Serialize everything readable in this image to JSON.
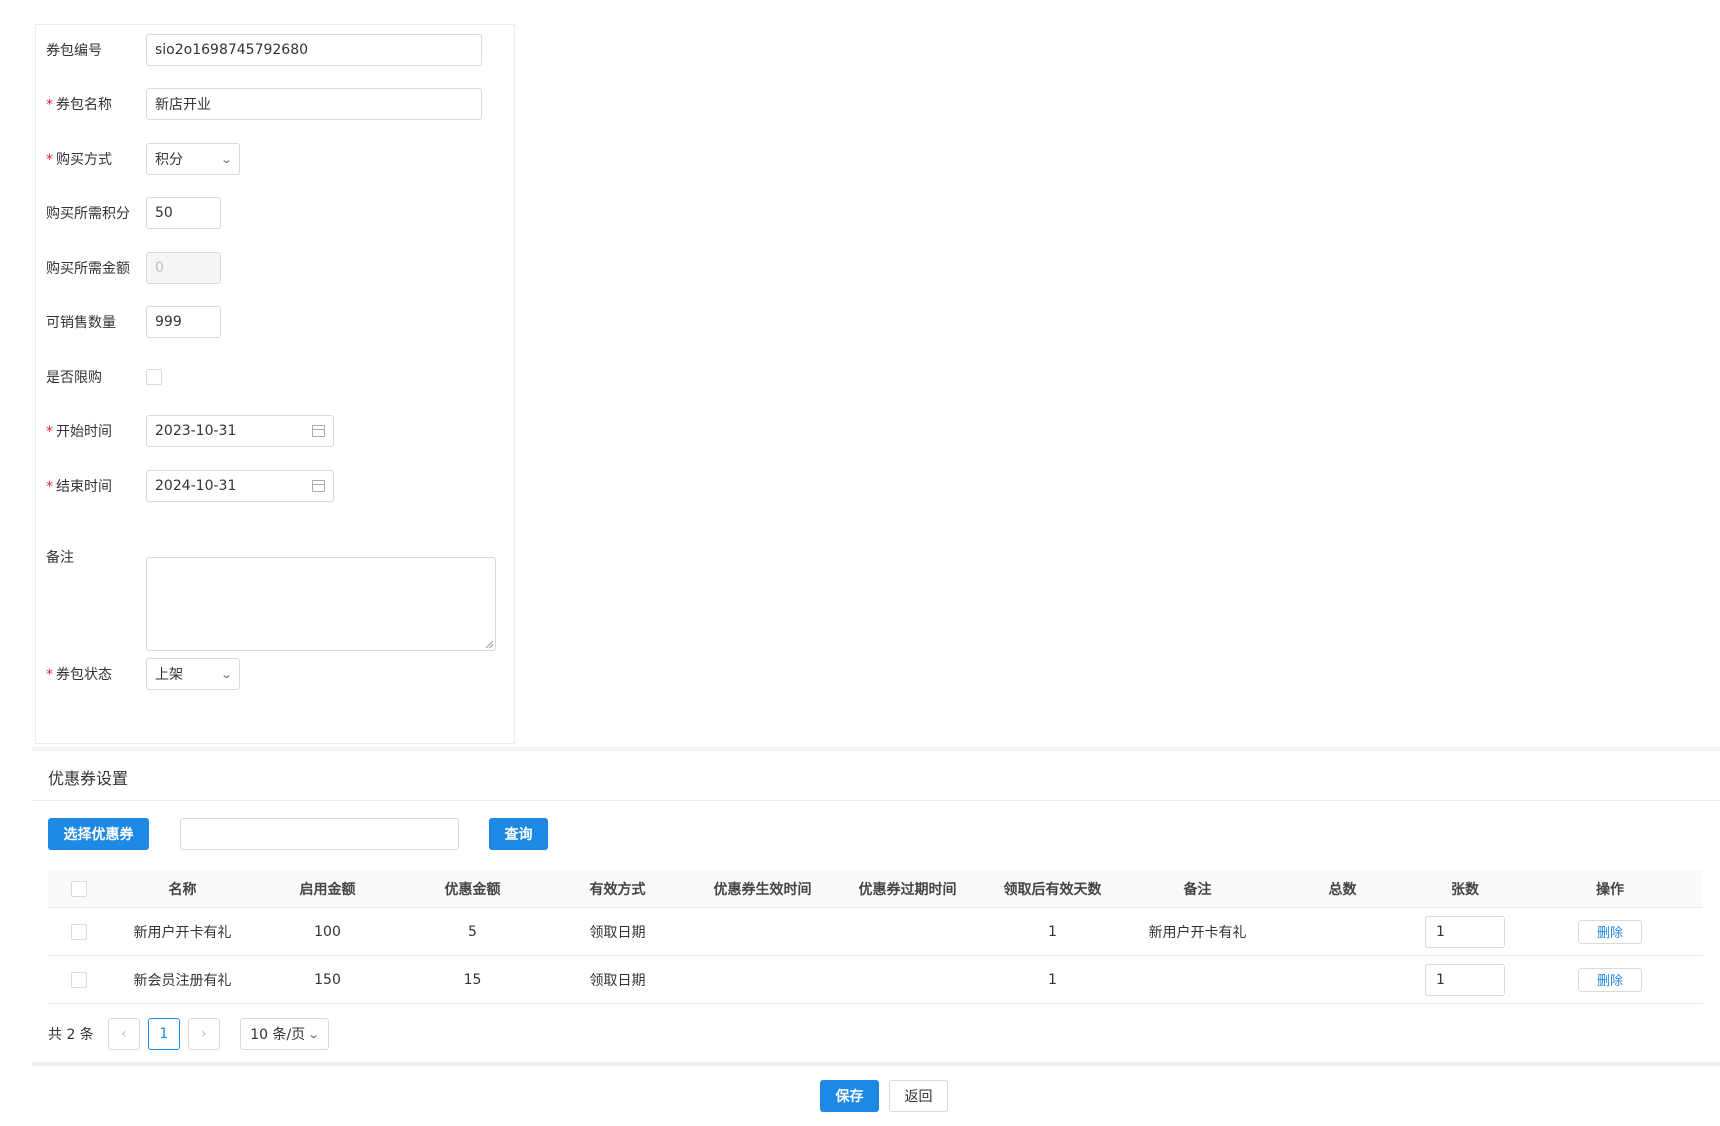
{
  "form": {
    "code_label": "券包编号",
    "code_value": "sio2o1698745792680",
    "name_label": "券包名称",
    "name_value": "新店开业",
    "buy_method_label": "购买方式",
    "buy_method_value": "积分",
    "points_label": "购买所需积分",
    "points_value": "50",
    "amount_label": "购买所需金额",
    "amount_value": "0",
    "sale_qty_label": "可销售数量",
    "sale_qty_value": "999",
    "limit_label": "是否限购",
    "limit_checked": false,
    "start_label": "开始时间",
    "start_value": "2023-10-31",
    "end_label": "结束时间",
    "end_value": "2024-10-31",
    "remark_label": "备注",
    "remark_value": "",
    "status_label": "券包状态",
    "status_value": "上架",
    "required_mark": "*"
  },
  "coupon": {
    "section_title": "优惠券设置",
    "select_button": "选择优惠券",
    "search_value": "",
    "query_button": "查询",
    "columns": [
      "名称",
      "启用金额",
      "优惠金额",
      "有效方式",
      "优惠券生效时间",
      "优惠券过期时间",
      "领取后有效天数",
      "备注",
      "总数",
      "张数",
      "操作"
    ],
    "rows": [
      {
        "name": "新用户开卡有礼",
        "enable_amount": "100",
        "discount": "5",
        "valid_mode": "领取日期",
        "start": "",
        "expire": "",
        "days": "1",
        "remark": "新用户开卡有礼",
        "total": "",
        "qty": "1",
        "action": "删除"
      },
      {
        "name": "新会员注册有礼",
        "enable_amount": "150",
        "discount": "15",
        "valid_mode": "领取日期",
        "start": "",
        "expire": "",
        "days": "1",
        "remark": "",
        "total": "",
        "qty": "1",
        "action": "删除"
      }
    ],
    "pager": {
      "total_text": "共 2 条",
      "current_page": "1",
      "page_size": "10 条/页"
    }
  },
  "footer": {
    "save_button": "保存",
    "back_button": "返回"
  },
  "colors": {
    "primary": "#1e88e5",
    "required": "#f5222d"
  },
  "icons": [
    "chevron-down-icon",
    "calendar-icon",
    "chevron-left-icon",
    "chevron-right-icon",
    "resize-handle-icon"
  ]
}
